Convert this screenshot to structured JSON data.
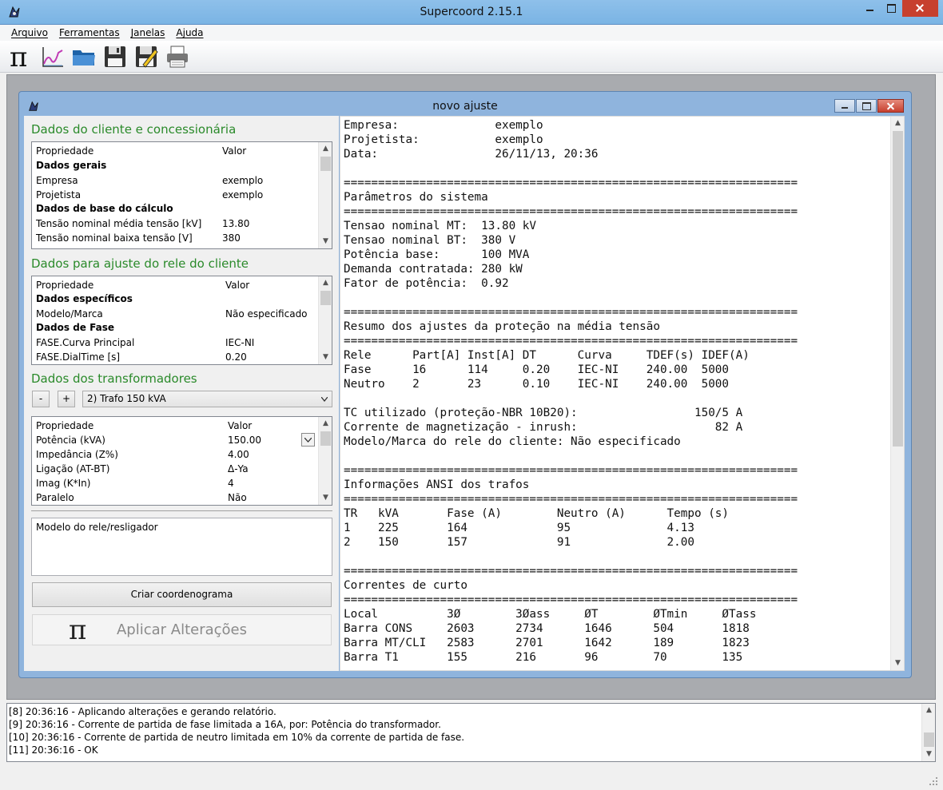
{
  "window": {
    "title": "Supercoord 2.15.1"
  },
  "menu": [
    "Arquivo",
    "Ferramentas",
    "Janelas",
    "Ajuda"
  ],
  "toolbar_icons": [
    "pi-icon",
    "chart-icon",
    "folder-open-icon",
    "save-icon",
    "save-as-icon",
    "print-icon"
  ],
  "child": {
    "title": "novo ajuste"
  },
  "client_section": {
    "title": "Dados do cliente e concessionária",
    "header": {
      "prop": "Propriedade",
      "val": "Valor"
    },
    "rows": [
      {
        "k": "Dados gerais",
        "v": "",
        "bold": true
      },
      {
        "k": "Empresa",
        "v": "exemplo"
      },
      {
        "k": "Projetista",
        "v": "exemplo"
      },
      {
        "k": "Dados de base do cálculo",
        "v": "",
        "bold": true
      },
      {
        "k": "Tensão nominal média tensão [kV]",
        "v": "13.80"
      },
      {
        "k": "Tensão nominal baixa tensão [V]",
        "v": "380"
      }
    ]
  },
  "relay_section": {
    "title": "Dados para ajuste do rele do cliente",
    "header": {
      "prop": "Propriedade",
      "val": "Valor"
    },
    "rows": [
      {
        "k": "Dados específicos",
        "v": "",
        "bold": true
      },
      {
        "k": "Modelo/Marca",
        "v": "Não especificado"
      },
      {
        "k": "Dados de Fase",
        "v": "",
        "bold": true
      },
      {
        "k": "FASE.Curva Principal",
        "v": "IEC-NI"
      },
      {
        "k": "FASE.DialTime [s]",
        "v": "0.20"
      }
    ]
  },
  "trafo_section": {
    "title": "Dados dos transformadores",
    "minus": "-",
    "plus": "+",
    "selected": "2) Trafo 150 kVA",
    "header": {
      "prop": "Propriedade",
      "val": "Valor"
    },
    "rows": [
      {
        "k": "Potência (kVA)",
        "v": "150.00"
      },
      {
        "k": "Impedância (Z%)",
        "v": "4.00"
      },
      {
        "k": "Ligação (AT-BT)",
        "v": "Δ-Ya"
      },
      {
        "k": "Imag (K*In)",
        "v": "4"
      },
      {
        "k": "Paralelo",
        "v": "Não"
      }
    ]
  },
  "model_box": "Modelo do rele/resligador",
  "buttons": {
    "create": "Criar coordenograma",
    "apply": "Aplicar Alterações",
    "apply_symbol": "π"
  },
  "report_lines": [
    "Empresa:              exemplo",
    "Projetista:           exemplo",
    "Data:                 26/11/13, 20:36",
    "",
    "==================================================================",
    "Parâmetros do sistema",
    "==================================================================",
    "Tensao nominal MT:  13.80 kV",
    "Tensao nominal BT:  380 V",
    "Potência base:      100 MVA",
    "Demanda contratada: 280 kW",
    "Fator de potência:  0.92",
    "",
    "==================================================================",
    "Resumo dos ajustes da proteção na média tensão",
    "==================================================================",
    "Rele      Part[A] Inst[A] DT      Curva     TDEF(s) IDEF(A)",
    "Fase      16      114     0.20    IEC-NI    240.00  5000",
    "Neutro    2       23      0.10    IEC-NI    240.00  5000",
    "",
    "TC utilizado (proteção-NBR 10B20):                 150/5 A",
    "Corrente de magnetização - inrush:                    82 A",
    "Modelo/Marca do rele do cliente: Não especificado",
    "",
    "==================================================================",
    "Informações ANSI dos trafos",
    "==================================================================",
    "TR   kVA       Fase (A)        Neutro (A)      Tempo (s)",
    "1    225       164             95              4.13",
    "2    150       157             91              2.00",
    "",
    "==================================================================",
    "Correntes de curto",
    "==================================================================",
    "Local          3Ø        3Øass     ØT        ØTmin     ØTass",
    "Barra CONS     2603      2734      1646      504       1818",
    "Barra MT/CLI   2583      2701      1642      189       1823",
    "Barra T1       155       216       96        70        135"
  ],
  "log_lines": [
    "[8] 20:36:16 - Aplicando alterações e gerando relatório.",
    "[9] 20:36:16 - Corrente de partida de fase limitada a 16A, por: Potência do transformador.",
    "[10] 20:36:16 - Corrente de partida de neutro limitada em 10% da corrente de partida de fase.",
    "[11] 20:36:16 - OK"
  ]
}
